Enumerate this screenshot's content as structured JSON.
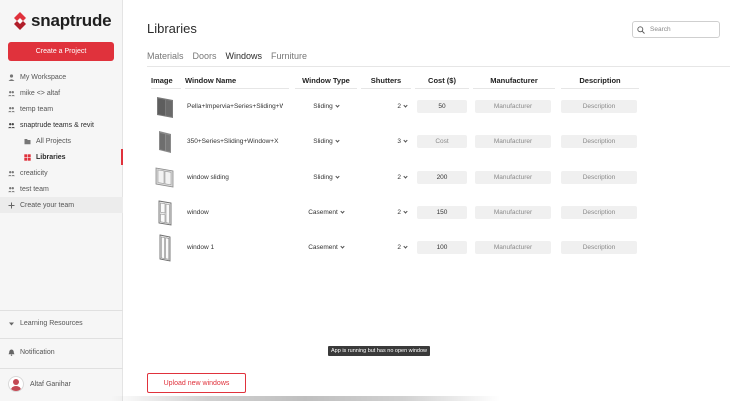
{
  "app": {
    "name": "snaptrude",
    "brand_color": "#e0323c"
  },
  "sidebar": {
    "create_label": "Create a Project",
    "items": [
      {
        "label": "My Workspace",
        "icon": "person-icon"
      },
      {
        "label": "mike <> altaf",
        "icon": "people-icon"
      },
      {
        "label": "temp team",
        "icon": "people-icon"
      },
      {
        "label": "snaptrude teams & revit",
        "icon": "people-icon"
      },
      {
        "label": "All Projects",
        "icon": "folder-icon"
      },
      {
        "label": "Libraries",
        "icon": "library-icon"
      },
      {
        "label": "creaticity",
        "icon": "people-icon"
      },
      {
        "label": "test team",
        "icon": "people-icon"
      },
      {
        "label": "Create your team",
        "icon": "plus-icon"
      }
    ],
    "learning_label": "Learning Resources",
    "notification_label": "Notification",
    "user_name": "Altaf Ganihar"
  },
  "main": {
    "title": "Libraries",
    "search_placeholder": "Search",
    "tabs": [
      "Materials",
      "Doors",
      "Windows",
      "Furniture"
    ],
    "active_tab": "Windows",
    "upload_label": "Upload new windows",
    "tooltip": "App is running but has no open window"
  },
  "table": {
    "headers": [
      "Image",
      "Window Name",
      "Window Type",
      "Shutters",
      "Cost ($)",
      "Manufacturer",
      "Description"
    ],
    "rows": [
      {
        "name": "Pella+Impervia+Series+Sliding+W",
        "type": "Sliding",
        "shutters": "2",
        "cost": "50",
        "manufacturer": "Manufacturer",
        "description": "Description",
        "thumb": "sliding-window-dark"
      },
      {
        "name": "350+Series+Sliding+Window+X",
        "type": "Sliding",
        "shutters": "3",
        "cost": "Cost",
        "manufacturer": "Manufacturer",
        "description": "Description",
        "thumb": "sliding-window-gray"
      },
      {
        "name": "window sliding",
        "type": "Sliding",
        "shutters": "2",
        "cost": "200",
        "manufacturer": "Manufacturer",
        "description": "Description",
        "thumb": "sliding-window-light"
      },
      {
        "name": "window",
        "type": "Casement",
        "shutters": "2",
        "cost": "150",
        "manufacturer": "Manufacturer",
        "description": "Description",
        "thumb": "casement-window"
      },
      {
        "name": "window 1",
        "type": "Casement",
        "shutters": "2",
        "cost": "100",
        "manufacturer": "Manufacturer",
        "description": "Description",
        "thumb": "casement-window-tall"
      }
    ]
  }
}
